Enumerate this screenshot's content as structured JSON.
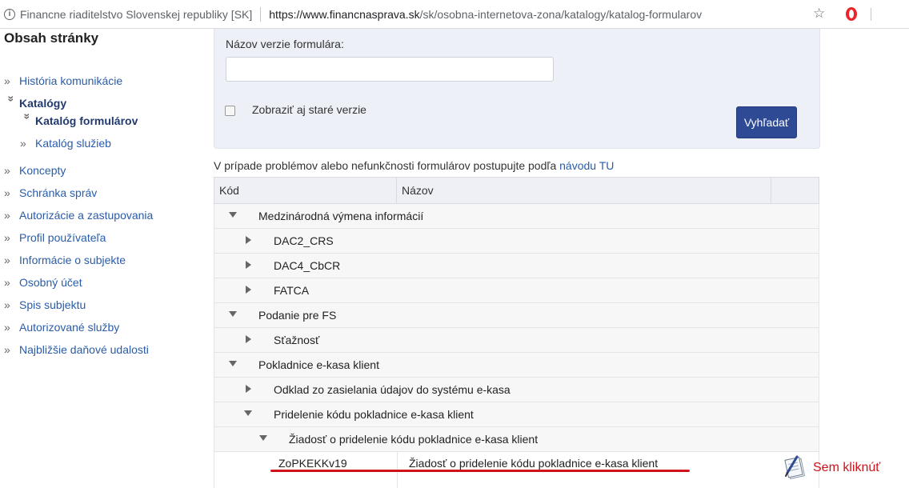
{
  "browser": {
    "site_name": "Financne riaditelstvo Slovenskej republiky [SK]",
    "url_host": "https://www.financnasprava.sk",
    "url_path": "/sk/osobna-internetova-zona/katalogy/katalog-formularov"
  },
  "sidebar": {
    "title": "Obsah stránky",
    "items": [
      {
        "label": "História komunikácie",
        "bullet": "»"
      },
      {
        "label": "Katalógy",
        "bullet": "»"
      },
      {
        "label": "Katalóg formulárov",
        "bullet": "»"
      },
      {
        "label": "Katalóg služieb",
        "bullet": "»"
      },
      {
        "label": "Koncepty",
        "bullet": "»"
      },
      {
        "label": "Schránka správ",
        "bullet": "»"
      },
      {
        "label": "Autorizácie a zastupovania",
        "bullet": "»"
      },
      {
        "label": "Profil používateľa",
        "bullet": "»"
      },
      {
        "label": "Informácie o subjekte",
        "bullet": "»"
      },
      {
        "label": "Osobný účet",
        "bullet": "»"
      },
      {
        "label": "Spis subjektu",
        "bullet": "»"
      },
      {
        "label": "Autorizované služby",
        "bullet": "»"
      },
      {
        "label": "Najbližšie daňové udalosti",
        "bullet": "»"
      }
    ]
  },
  "search": {
    "label": "Názov verzie formulára:",
    "input_value": "",
    "checkbox_label": "Zobraziť aj staré verzie",
    "button_label": "Vyhľadať"
  },
  "info": {
    "text": "V prípade problémov alebo nefunkčnosti formulárov postupujte podľa ",
    "link": "návodu TU"
  },
  "table": {
    "headers": [
      "Kód",
      "Názov"
    ],
    "rows": [
      "Medzinárodná výmena informácií",
      "DAC2_CRS",
      "DAC4_CbCR",
      "FATCA",
      "Podanie pre FS",
      "Sťažnosť",
      "Pokladnice e-kasa klient",
      "Odklad zo zasielania údajov do systému e-kasa",
      "Pridelenie kódu pokladnice e-kasa klient",
      "Žiadosť o pridelenie kódu pokladnice e-kasa klient"
    ],
    "form_row": {
      "code": "ZoPKEKKv19",
      "name": "Žiadosť o pridelenie kódu pokladnice e-kasa klient"
    }
  },
  "annotation": {
    "text": "Sem kliknúť"
  },
  "colors": {
    "link": "#2a5caa",
    "button": "#2e4a94",
    "annotation": "#d0121b"
  }
}
